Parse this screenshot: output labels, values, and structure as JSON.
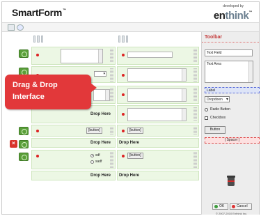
{
  "header": {
    "app_title": "SmartForm",
    "tm": "™",
    "developed_by": "developed by",
    "brand_en": "en",
    "brand_think": "think",
    "brand_tm": "™"
  },
  "callout": {
    "line1": "Drag & Drop",
    "line2": "Interface"
  },
  "builder": {
    "drop_here": "Drop Here",
    "button_text": "[button]",
    "radio_options": [
      "sdf",
      "sadf"
    ]
  },
  "toolbar": {
    "title": "Toolbar",
    "text_field": "Text Field",
    "text_area": "Text Area",
    "label": "Label",
    "dropdown": "Dropdown",
    "radio_button": "Radio Button",
    "checkbox": "Checkbox",
    "button": "Button",
    "spacer": "[ Spacer ]",
    "ok": "OK",
    "cancel": "Cancel",
    "copyright": "© 2007-2010 Enthink Inc."
  },
  "colors": {
    "accent_red": "#e2383a",
    "cell_green": "#ecf7e4",
    "row_green": "#5a9e3a",
    "label_blue": "#dde4f7"
  }
}
